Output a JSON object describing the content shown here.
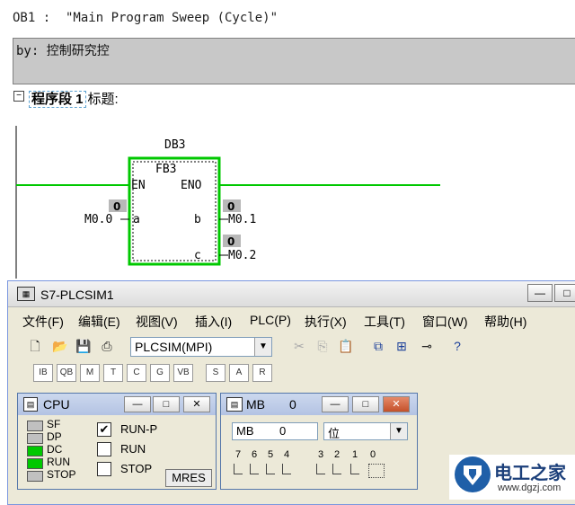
{
  "editor": {
    "block_title": "OB1 :  \"Main Program Sweep (Cycle)\"",
    "comment": "by: 控制研究控",
    "network_expander": "−",
    "network_label": "程序段 1",
    "network_sep": ":",
    "network_title": "标题:",
    "ladder": {
      "instance_db": "DB3",
      "function_block": "FB3",
      "pin_en": "EN",
      "pin_eno": "ENO",
      "pin_a": "a",
      "pin_b": "b",
      "pin_c": "c",
      "input_a_value": "0",
      "input_a_address": "M0.0",
      "output_b_value": "0",
      "output_b_address": "M0.1",
      "output_c_value": "0",
      "output_c_address": "M0.2",
      "power_color": "#00c800"
    }
  },
  "plcsim": {
    "title": "S7-PLCSIM1",
    "app_icon": "plcsim-icon",
    "menu": [
      "文件(F)",
      "编辑(E)",
      "视图(V)",
      "插入(I)",
      "PLC(P)",
      "执行(X)",
      "工具(T)",
      "窗口(W)",
      "帮助(H)"
    ],
    "connection_select": "PLCSIM(MPI)",
    "cpu": {
      "title": "CPU",
      "leds": [
        {
          "label": "SF",
          "color": "#c0c0c0"
        },
        {
          "label": "DP",
          "color": "#c0c0c0"
        },
        {
          "label": "DC",
          "color": "#00c800"
        },
        {
          "label": "RUN",
          "color": "#00c800"
        },
        {
          "label": "STOP",
          "color": "#c0c0c0"
        }
      ],
      "modes": [
        {
          "label": "RUN-P",
          "checked": true
        },
        {
          "label": "RUN",
          "checked": false
        },
        {
          "label": "STOP",
          "checked": false
        }
      ],
      "mres_label": "MRES"
    },
    "mb": {
      "title": "MB",
      "title_address": "0",
      "area": "MB",
      "address": "0",
      "format": "位",
      "bits": [
        "7",
        "6",
        "5",
        "4",
        "3",
        "2",
        "1",
        "0"
      ]
    }
  },
  "watermark": {
    "name": "电工之家",
    "url": "www.dgzj.com"
  }
}
